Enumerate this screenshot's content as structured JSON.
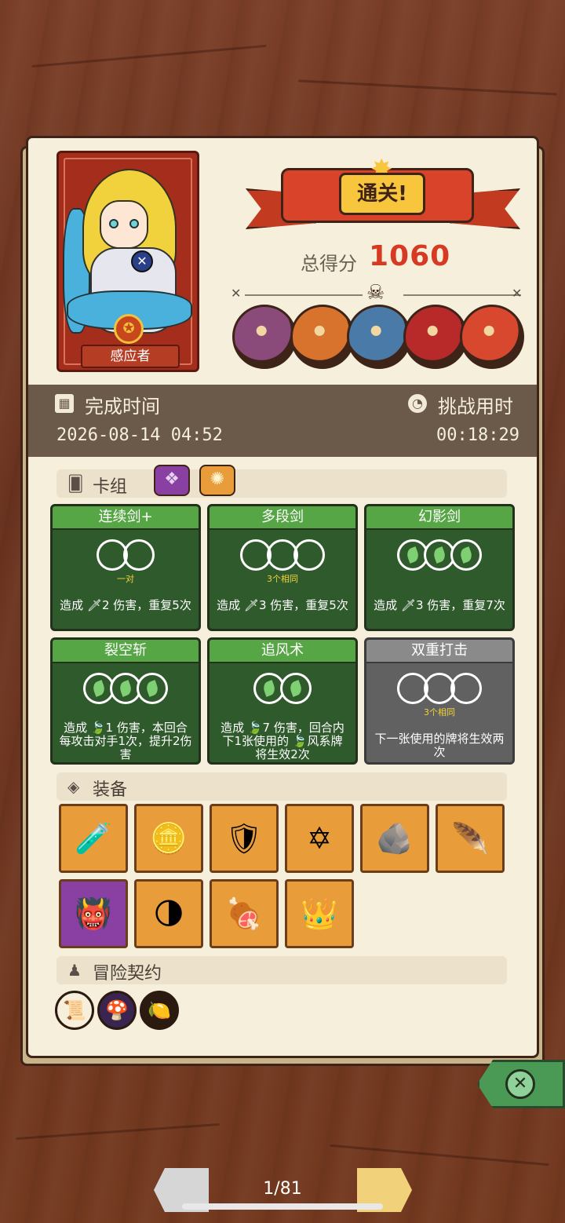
{
  "character": {
    "name": "感应者"
  },
  "result": {
    "banner": "通关!",
    "score_label": "总得分",
    "score_value": "1060"
  },
  "bosses": [
    {
      "name": "stone-golem",
      "color": "#8a4a7a"
    },
    {
      "name": "orange-ogre",
      "color": "#d8732e"
    },
    {
      "name": "armored-knight",
      "color": "#4a7aa8"
    },
    {
      "name": "red-demon",
      "color": "#b82a2a"
    },
    {
      "name": "rainbow-dragon",
      "color": "#d8482e"
    }
  ],
  "times": {
    "completion_label": "完成时间",
    "completion_value": "2026-08-14 04:52",
    "challenge_label": "挑战用时",
    "challenge_value": "00:18:29"
  },
  "deck": {
    "label": "卡组",
    "cards": [
      {
        "title": "连续剑+",
        "sub": "一对",
        "desc": "造成 🗡2 伤害，重复5次",
        "orbs": 2,
        "leaf": false,
        "gray": false
      },
      {
        "title": "多段剑",
        "sub": "3个相同",
        "desc": "造成 🗡3 伤害，重复5次",
        "orbs": 3,
        "leaf": false,
        "gray": false
      },
      {
        "title": "幻影剑",
        "sub": "",
        "desc": "造成 🗡3 伤害，重复7次",
        "orbs": 3,
        "leaf": true,
        "gray": false
      },
      {
        "title": "裂空斩",
        "sub": "",
        "desc": "造成 🍃1 伤害，本回合每攻击对手1次，提升2伤害",
        "orbs": 3,
        "leaf": true,
        "gray": false
      },
      {
        "title": "追风术",
        "sub": "",
        "desc": "造成 🍃7 伤害，回合内下1张使用的 🍃风系牌 将生效2次",
        "orbs": 2,
        "leaf": true,
        "gray": false
      },
      {
        "title": "双重打击",
        "sub": "3个相同",
        "desc": "下一张使用的牌将生效两次",
        "orbs": 3,
        "leaf": false,
        "gray": true
      }
    ]
  },
  "equipment": {
    "label": "装备",
    "items": [
      {
        "icon": "potion-icon",
        "glyph": "🧪",
        "purple": false
      },
      {
        "icon": "coin-token-icon",
        "glyph": "🪙",
        "purple": false
      },
      {
        "icon": "blue-shield-icon",
        "glyph": "🛡",
        "purple": false
      },
      {
        "icon": "hexagram-icon",
        "glyph": "✡",
        "purple": false
      },
      {
        "icon": "green-stone-icon",
        "glyph": "🪨",
        "purple": false
      },
      {
        "icon": "feather-icon",
        "glyph": "🪶",
        "purple": false
      },
      {
        "icon": "demon-mask-icon",
        "glyph": "👹",
        "purple": true
      },
      {
        "icon": "moon-orb-icon",
        "glyph": "🌗",
        "purple": false
      },
      {
        "icon": "meat-icon",
        "glyph": "🍖",
        "purple": false
      },
      {
        "icon": "crown-icon",
        "glyph": "👑",
        "purple": false
      }
    ]
  },
  "contracts": {
    "label": "冒险契约",
    "items": [
      {
        "icon": "scroll-icon",
        "glyph": "📜",
        "bg": "#f6efdc"
      },
      {
        "icon": "mushroom-icon",
        "glyph": "🍄",
        "bg": "#3a2450"
      },
      {
        "icon": "lemon-coin-icon",
        "glyph": "🍋",
        "bg": "#2a1a10"
      }
    ]
  },
  "pager": {
    "text": "1/81"
  }
}
